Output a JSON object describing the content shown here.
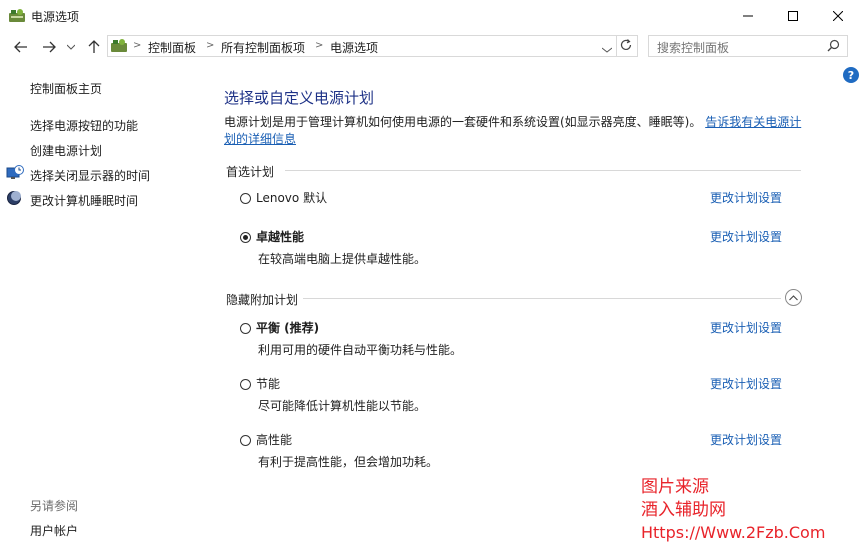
{
  "window": {
    "title": "电源选项",
    "minimize_icon": "minimize-icon",
    "maximize_icon": "maximize-icon",
    "close_icon": "close-icon"
  },
  "address": {
    "breadcrumb": [
      "控制面板",
      "所有控制面板项",
      "电源选项"
    ],
    "search_placeholder": "搜索控制面板"
  },
  "sidebar": {
    "home": "控制面板主页",
    "items": [
      {
        "label": "选择电源按钮的功能",
        "icon": ""
      },
      {
        "label": "创建电源计划",
        "icon": ""
      },
      {
        "label": "选择关闭显示器的时间",
        "icon": "display-clock-icon"
      },
      {
        "label": "更改计算机睡眠时间",
        "icon": "moon-icon"
      }
    ],
    "see_also_title": "另请参阅",
    "see_also_items": [
      "用户帐户"
    ]
  },
  "main": {
    "heading": "选择或自定义电源计划",
    "intro_text": "电源计划是用于管理计算机如何使用电源的一套硬件和系统设置(如显示器亮度、睡眠等)。",
    "intro_link": "告诉我有关电源计划的详细信息",
    "preferred_title": "首选计划",
    "hidden_title": "隐藏附加计划",
    "change_label": "更改计划设置",
    "preferred_plans": [
      {
        "name": "Lenovo 默认",
        "desc": "",
        "selected": false
      },
      {
        "name": "卓越性能",
        "desc": "在较高端电脑上提供卓越性能。",
        "selected": true
      }
    ],
    "hidden_plans": [
      {
        "name": "平衡 (推荐)",
        "desc": "利用可用的硬件自动平衡功耗与性能。",
        "selected": false
      },
      {
        "name": "节能",
        "desc": "尽可能降低计算机性能以节能。",
        "selected": false
      },
      {
        "name": "高性能",
        "desc": "有利于提高性能，但会增加功耗。",
        "selected": false
      }
    ]
  },
  "watermark": {
    "line1": "图片来源",
    "line2": "酒入辅助网",
    "line3": "Https://Www.2Fzb.Com"
  }
}
